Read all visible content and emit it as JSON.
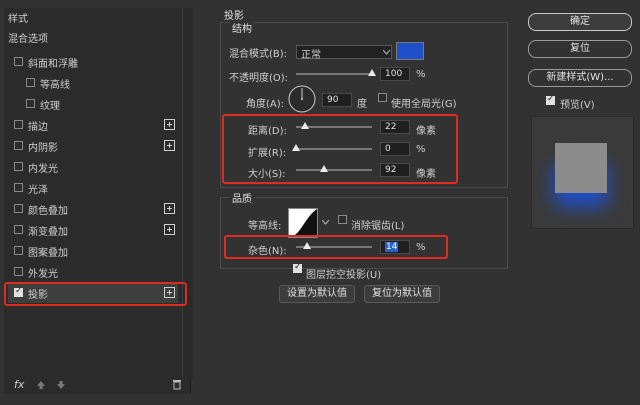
{
  "left": {
    "header_styles": "样式",
    "header_blend": "混合选项",
    "items": [
      {
        "label": "斜面和浮雕",
        "checked": false,
        "plus": false
      },
      {
        "label": "等高线",
        "checked": false,
        "plus": false
      },
      {
        "label": "纹理",
        "checked": false,
        "plus": false
      },
      {
        "label": "描边",
        "checked": false,
        "plus": true
      },
      {
        "label": "内阴影",
        "checked": false,
        "plus": true
      },
      {
        "label": "内发光",
        "checked": false,
        "plus": false
      },
      {
        "label": "光泽",
        "checked": false,
        "plus": false
      },
      {
        "label": "颜色叠加",
        "checked": false,
        "plus": true
      },
      {
        "label": "渐变叠加",
        "checked": false,
        "plus": true
      },
      {
        "label": "图案叠加",
        "checked": false,
        "plus": false
      },
      {
        "label": "外发光",
        "checked": false,
        "plus": false
      },
      {
        "label": "投影",
        "checked": true,
        "plus": true
      }
    ],
    "fx_label": "fx"
  },
  "panel": {
    "title": "投影",
    "structure": {
      "title": "结构",
      "blend_mode_label": "混合模式(B):",
      "blend_mode_value": "正常",
      "shadow_color": "#1f4fc9",
      "opacity_label": "不透明度(O):",
      "opacity_value": "100",
      "opacity_unit": "%",
      "opacity_level": 1.0,
      "angle_label": "角度(A):",
      "angle_value": "90",
      "angle_unit": "度",
      "global_light_label": "使用全局光(G)",
      "global_light_checked": false,
      "distance_label": "距离(D):",
      "distance_value": "22",
      "distance_unit": "像素",
      "distance_level": 0.12,
      "spread_label": "扩展(R):",
      "spread_value": "0",
      "spread_unit": "%",
      "spread_level": 0.0,
      "size_label": "大小(S):",
      "size_value": "92",
      "size_unit": "像素",
      "size_level": 0.37
    },
    "quality": {
      "title": "品质",
      "contour_label": "等高线:",
      "anti_alias_label": "消除锯齿(L)",
      "anti_alias_checked": false,
      "noise_label": "杂色(N):",
      "noise_value": "14",
      "noise_unit": "%",
      "noise_level": 0.14
    },
    "knockout_label": "图层挖空投影(U)",
    "knockout_checked": true,
    "set_default_label": "设置为默认值",
    "reset_default_label": "复位为默认值"
  },
  "right": {
    "ok_label": "确定",
    "reset_label": "复位",
    "new_style_label": "新建样式(W)...",
    "preview_label": "预览(V)",
    "preview_checked": true
  }
}
